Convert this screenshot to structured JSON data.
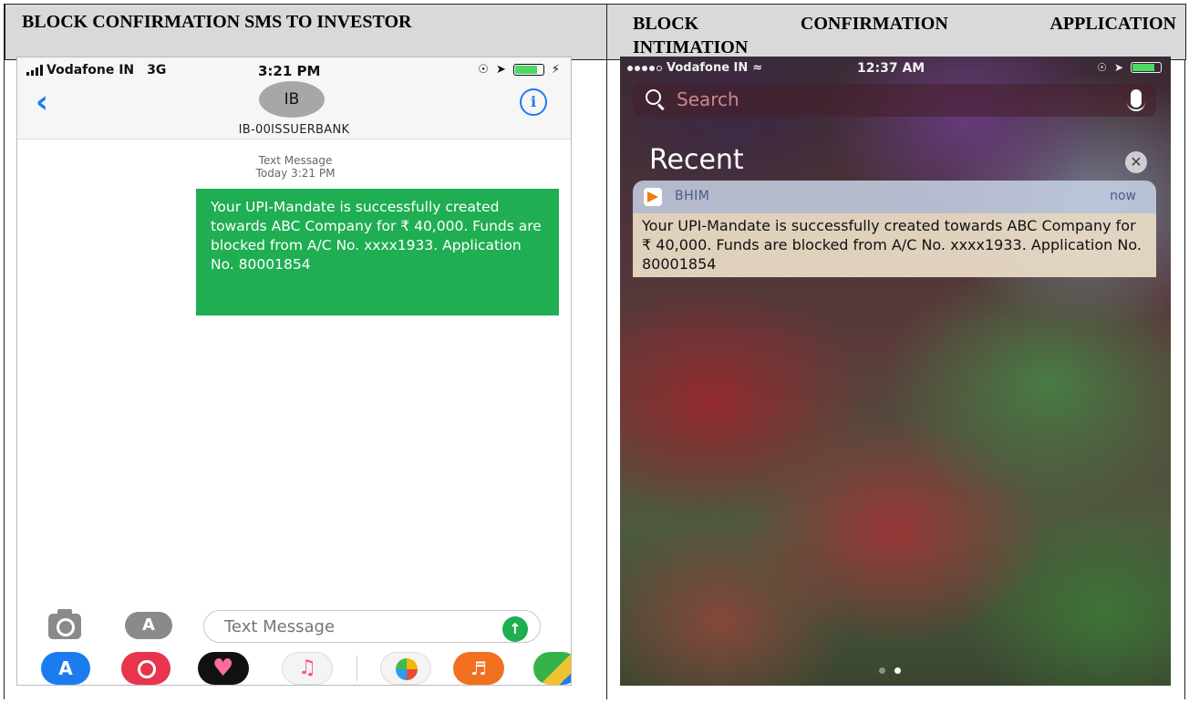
{
  "headers": {
    "left": "BLOCK CONFIRMATION SMS TO INVESTOR",
    "right_line1_words": [
      "BLOCK",
      "CONFIRMATION",
      "APPLICATION"
    ],
    "right_line2": "INTIMATION"
  },
  "sms_screen": {
    "status": {
      "carrier": "Vodafone IN",
      "network": "3G",
      "time": "3:21 PM"
    },
    "contact": {
      "avatar_initials": "IB",
      "sender_id": "IB-00ISSUERBANK"
    },
    "message_meta": {
      "type": "Text Message",
      "timestamp": "Today 3:21 PM"
    },
    "message_text": "Your UPI-Mandate is successfully created towards ABC Company for ₹ 40,000. Funds are blocked from A/C No. xxxx1933. Application No. 80001854",
    "composer_placeholder": "Text Message",
    "icons": [
      "back-chevron-icon",
      "info-icon",
      "camera-icon",
      "app-store-icon",
      "send-arrow-icon"
    ],
    "tray_apps": [
      "app-store",
      "web-search",
      "digital-touch",
      "music",
      "photos",
      "garageband",
      "maps"
    ]
  },
  "notification_screen": {
    "status": {
      "carrier": "Vodafone IN",
      "time": "12:37 AM"
    },
    "search_placeholder": "Search",
    "section_title": "Recent",
    "notification": {
      "app_name": "BHIM",
      "time": "now",
      "body": "Your UPI-Mandate is successfully created towards ABC Company for ₹ 40,000. Funds are blocked from A/C No. xxxx1933. Application No. 80001854"
    },
    "page_count": 2,
    "current_page": 2
  },
  "colors": {
    "header_bg": "#d9d9d9",
    "sms_bubble": "#1fae52",
    "ios_blue": "#1a7cf5",
    "bhim_orange": "#f07a10"
  }
}
